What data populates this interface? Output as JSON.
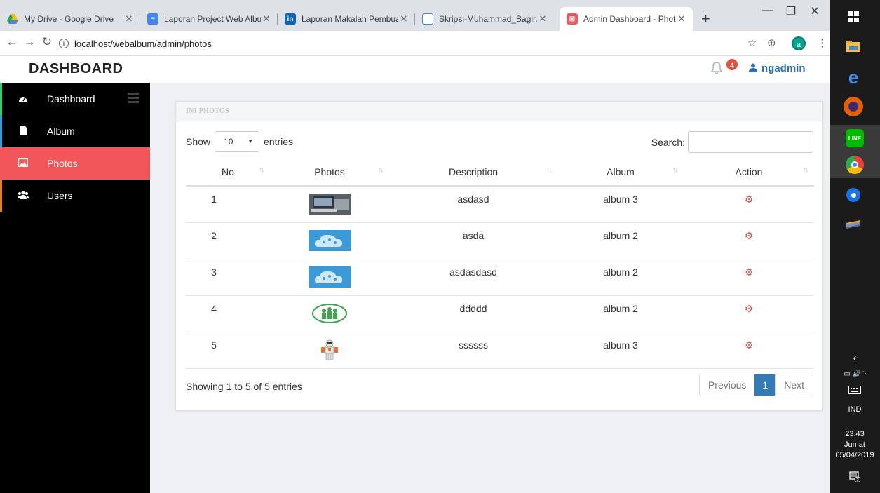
{
  "browser": {
    "tabs": [
      {
        "title": "My Drive - Google Drive",
        "icon": "drive-icon",
        "color": "#1fa463"
      },
      {
        "title": "Laporan Project Web Album",
        "icon": "docs-icon",
        "color": "#4285f4"
      },
      {
        "title": "Laporan Makalah Pembuata",
        "icon": "linkedin-icon",
        "color": "#0a66c2"
      },
      {
        "title": "Skripsi-Muhammad_Bagir.p",
        "icon": "file-icon",
        "color": "#4285f4"
      },
      {
        "title": "Admin Dashboard - Photos",
        "icon": "app-icon",
        "color": "#f1565b"
      }
    ],
    "url": "localhost/webalbum/admin/photos",
    "profile_initial": "a"
  },
  "app": {
    "brand": "DASHBOARD",
    "notification_count": "4",
    "username": "ngadmin"
  },
  "sidebar": {
    "items": [
      {
        "label": "Dashboard",
        "icon": "dashboard-icon",
        "bar_color": "#2ecc71"
      },
      {
        "label": "Album",
        "icon": "file-icon",
        "bar_color": "#3498db"
      },
      {
        "label": "Photos",
        "icon": "image-icon",
        "bar_color": "#f1565b",
        "active": true
      },
      {
        "label": "Users",
        "icon": "users-icon",
        "bar_color": "#e67e22"
      }
    ]
  },
  "panel": {
    "title": "INI PHOTOS",
    "show_label": "Show",
    "page_length": "10",
    "entries_label": "entries",
    "search_label": "Search:",
    "search_value": "",
    "columns": [
      "No",
      "Photos",
      "Description",
      "Album",
      "Action"
    ],
    "rows": [
      {
        "no": "1",
        "description": "asdasd",
        "album": "album 3",
        "thumb": "photo-thumb-laptop"
      },
      {
        "no": "2",
        "description": "asda",
        "album": "album 2",
        "thumb": "photo-thumb-cloud"
      },
      {
        "no": "3",
        "description": "asdasdasd",
        "album": "album 2",
        "thumb": "photo-thumb-cloud"
      },
      {
        "no": "4",
        "description": "ddddd",
        "album": "album 2",
        "thumb": "photo-thumb-team-logo"
      },
      {
        "no": "5",
        "description": "ssssss",
        "album": "album 3",
        "thumb": "photo-thumb-robot"
      }
    ],
    "info": "Showing 1 to 5 of 5 entries",
    "pager": {
      "previous": "Previous",
      "current": "1",
      "next": "Next"
    }
  },
  "taskbar": {
    "language": "IND",
    "time": "23.43",
    "day": "Jumat",
    "date": "05/04/2019",
    "notifications": "2"
  }
}
